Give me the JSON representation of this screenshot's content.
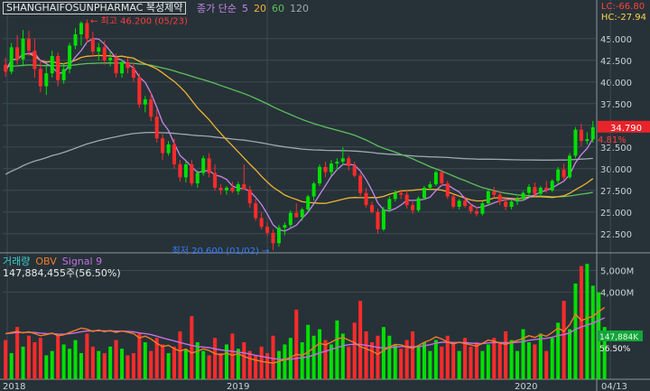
{
  "header": {
    "symbol": "SHANGHAIFOSUNPHARMAC",
    "name": "복성제약",
    "ma_label": "종가 단순",
    "ma_periods": [
      "5",
      "20",
      "60",
      "120"
    ],
    "ma_colors": [
      "#c586e6",
      "#f2b233",
      "#5fbf5f",
      "#9ea7ad"
    ],
    "lc": "LC:-66.80",
    "hc": "HC:-27.94"
  },
  "annotations": {
    "high": "최고 46.200 (05/23)",
    "low": "최저 20.600 (01/02)",
    "last_price": "34.790",
    "last_change": "4.81%"
  },
  "volume_panel": {
    "labels": [
      "거래량",
      "OBV",
      "Signal 9"
    ],
    "label_colors": [
      "#3fd0d0",
      "#f27b2a",
      "#c56fe0"
    ],
    "value": "147,884,455주(56.50%)",
    "last_box": "147,884K",
    "last_pct": "56.50%"
  },
  "colors": {
    "up": "#00e000",
    "down": "#ff2b2b",
    "bg": "#263238",
    "grid": "#3c4a52",
    "obv": "#f27b2a",
    "signal": "#c56fe0",
    "price_box": "#e8232a"
  },
  "chart_data": [
    {
      "type": "candlestick",
      "title": "SHANGHAIFOSUNPHARMAC 복성제약",
      "x_ticks": [
        "2018",
        "2019",
        "2020",
        "04/13"
      ],
      "y_ticks": [
        "22.500",
        "25.000",
        "27.500",
        "30.000",
        "32.500",
        "35.000",
        "37.500",
        "40.000",
        "42.500",
        "45.000"
      ],
      "ylim": [
        20.5,
        48
      ],
      "legend": [
        "종가 단순 5",
        "20",
        "60",
        "120"
      ],
      "candles": [
        [
          42.0,
          42.8,
          40.6,
          41.2
        ],
        [
          41.2,
          44.5,
          40.9,
          44.0
        ],
        [
          44.0,
          45.4,
          42.0,
          42.6
        ],
        [
          42.6,
          46.0,
          41.8,
          45.0
        ],
        [
          45.0,
          45.9,
          43.0,
          43.6
        ],
        [
          43.6,
          45.0,
          40.5,
          41.5
        ],
        [
          41.5,
          42.5,
          38.8,
          39.5
        ],
        [
          39.5,
          42.0,
          38.5,
          41.0
        ],
        [
          41.0,
          43.6,
          40.5,
          43.0
        ],
        [
          43.0,
          43.4,
          39.5,
          40.2
        ],
        [
          40.2,
          42.2,
          39.8,
          41.5
        ],
        [
          41.5,
          44.5,
          41.0,
          44.2
        ],
        [
          44.2,
          46.2,
          43.8,
          45.5
        ],
        [
          45.5,
          47.0,
          44.2,
          46.8
        ],
        [
          46.8,
          47.2,
          44.5,
          45.0
        ],
        [
          45.0,
          45.8,
          43.0,
          43.5
        ],
        [
          43.5,
          44.5,
          42.5,
          44.0
        ],
        [
          44.0,
          44.8,
          42.0,
          42.5
        ],
        [
          42.5,
          43.5,
          41.8,
          42.8
        ],
        [
          42.8,
          43.3,
          40.5,
          41.0
        ],
        [
          41.0,
          42.6,
          40.5,
          42.3
        ],
        [
          42.3,
          42.8,
          41.0,
          41.6
        ],
        [
          41.6,
          42.2,
          40.0,
          40.5
        ],
        [
          40.5,
          41.0,
          37.0,
          37.4
        ],
        [
          37.4,
          38.4,
          36.5,
          38.0
        ],
        [
          38.0,
          38.8,
          35.5,
          36.0
        ],
        [
          36.0,
          36.8,
          33.0,
          33.5
        ],
        [
          33.5,
          34.0,
          31.0,
          31.8
        ],
        [
          31.8,
          33.2,
          31.5,
          32.8
        ],
        [
          32.8,
          33.5,
          30.0,
          30.5
        ],
        [
          30.5,
          31.0,
          28.5,
          29.0
        ],
        [
          29.0,
          30.8,
          28.4,
          30.5
        ],
        [
          30.5,
          31.0,
          28.0,
          28.3
        ],
        [
          28.3,
          29.8,
          27.8,
          29.5
        ],
        [
          29.5,
          31.5,
          29.2,
          31.2
        ],
        [
          31.2,
          31.8,
          29.0,
          29.5
        ],
        [
          29.5,
          30.5,
          27.5,
          27.8
        ],
        [
          27.8,
          28.2,
          27.0,
          27.5
        ],
        [
          27.5,
          28.0,
          27.0,
          27.8
        ],
        [
          27.8,
          28.5,
          27.2,
          27.4
        ],
        [
          27.4,
          28.5,
          27.0,
          28.2
        ],
        [
          28.2,
          30.5,
          27.8,
          27.6
        ],
        [
          27.6,
          28.0,
          25.5,
          26.0
        ],
        [
          26.0,
          26.5,
          24.0,
          24.3
        ],
        [
          24.3,
          25.0,
          23.0,
          23.3
        ],
        [
          23.3,
          23.8,
          22.2,
          22.6
        ],
        [
          22.6,
          23.0,
          20.6,
          21.4
        ],
        [
          21.4,
          23.5,
          21.0,
          23.2
        ],
        [
          23.2,
          23.8,
          22.3,
          23.5
        ],
        [
          23.5,
          25.2,
          23.2,
          24.9
        ],
        [
          24.9,
          26.0,
          24.5,
          24.4
        ],
        [
          24.4,
          25.5,
          24.0,
          25.3
        ],
        [
          25.3,
          27.0,
          25.0,
          26.8
        ],
        [
          26.8,
          28.5,
          26.3,
          28.3
        ],
        [
          28.3,
          30.5,
          28.0,
          30.2
        ],
        [
          30.2,
          30.8,
          29.0,
          29.6
        ],
        [
          29.6,
          31.0,
          29.2,
          30.6
        ],
        [
          30.6,
          31.2,
          29.8,
          30.8
        ],
        [
          30.8,
          32.5,
          30.4,
          31.2
        ],
        [
          31.2,
          31.5,
          29.8,
          30.3
        ],
        [
          30.3,
          30.8,
          29.0,
          29.2
        ],
        [
          29.2,
          29.5,
          26.8,
          27.2
        ],
        [
          27.2,
          27.8,
          25.5,
          25.8
        ],
        [
          25.8,
          26.2,
          24.8,
          25.0
        ],
        [
          25.0,
          25.4,
          22.5,
          23.0
        ],
        [
          23.0,
          25.6,
          22.8,
          25.3
        ],
        [
          25.3,
          26.8,
          25.0,
          26.5
        ],
        [
          26.5,
          27.5,
          26.2,
          27.2
        ],
        [
          27.2,
          27.6,
          26.5,
          27.0
        ],
        [
          27.0,
          27.5,
          25.4,
          25.8
        ],
        [
          25.8,
          26.2,
          24.8,
          25.2
        ],
        [
          25.2,
          26.8,
          25.0,
          26.6
        ],
        [
          26.6,
          28.0,
          26.4,
          27.8
        ],
        [
          27.8,
          28.5,
          27.5,
          28.2
        ],
        [
          28.2,
          29.8,
          28.0,
          29.6
        ],
        [
          29.6,
          29.9,
          28.0,
          28.3
        ],
        [
          28.3,
          28.6,
          26.5,
          26.8
        ],
        [
          26.8,
          27.0,
          25.4,
          25.6
        ],
        [
          25.6,
          26.5,
          25.3,
          26.3
        ],
        [
          26.3,
          26.8,
          25.5,
          25.7
        ],
        [
          25.7,
          26.0,
          24.8,
          25.1
        ],
        [
          25.1,
          25.6,
          24.5,
          24.8
        ],
        [
          24.8,
          26.2,
          24.6,
          26.0
        ],
        [
          26.0,
          27.6,
          25.8,
          27.4
        ],
        [
          27.4,
          27.9,
          26.6,
          27.0
        ],
        [
          27.0,
          27.4,
          25.8,
          26.2
        ],
        [
          26.2,
          26.6,
          25.2,
          25.6
        ],
        [
          25.6,
          26.4,
          25.3,
          26.2
        ],
        [
          26.2,
          26.8,
          25.8,
          26.5
        ],
        [
          26.5,
          27.4,
          26.3,
          27.2
        ],
        [
          27.2,
          28.2,
          26.9,
          27.9
        ],
        [
          27.9,
          28.4,
          26.8,
          27.1
        ],
        [
          27.1,
          28.0,
          26.8,
          27.8
        ],
        [
          27.8,
          28.6,
          27.2,
          27.5
        ],
        [
          27.5,
          28.8,
          27.3,
          28.6
        ],
        [
          28.6,
          30.2,
          28.2,
          29.9
        ],
        [
          29.9,
          30.6,
          28.6,
          29.0
        ],
        [
          29.0,
          31.8,
          28.8,
          31.5
        ],
        [
          31.5,
          34.8,
          31.2,
          34.5
        ],
        [
          34.5,
          35.2,
          32.6,
          33.2
        ],
        [
          33.2,
          34.2,
          32.8,
          33.4
        ],
        [
          33.4,
          35.5,
          33.0,
          34.79
        ]
      ]
    },
    {
      "type": "bar",
      "title": "거래량 / OBV / Signal 9",
      "y_ticks": [
        "4,000M",
        "5,000M"
      ],
      "legend": [
        "거래량",
        "OBV",
        "Signal 9"
      ],
      "volume_m": [
        1800,
        1200,
        2400,
        1500,
        2000,
        1700,
        1900,
        1100,
        1300,
        2000,
        1600,
        1400,
        1800,
        1200,
        2100,
        1500,
        1300,
        1200,
        1500,
        1800,
        1400,
        1100,
        1200,
        2100,
        1700,
        1300,
        1900,
        1600,
        1200,
        1500,
        2200,
        1400,
        2900,
        1700,
        1300,
        1100,
        1900,
        1200,
        1600,
        2100,
        1400,
        1700,
        1300,
        1100,
        1500,
        1200,
        2000,
        1300,
        1600,
        1900,
        3200,
        1700,
        2500,
        2000,
        2300,
        1800,
        1600,
        2700,
        2100,
        1500,
        2600,
        3600,
        2200,
        1700,
        2000,
        2400,
        2000,
        1600,
        1400,
        1800,
        2200,
        1500,
        1700,
        1300,
        1800,
        1500,
        2000,
        1600,
        1300,
        1900,
        1500,
        1700,
        1300,
        1600,
        1900,
        1700,
        2200,
        1800,
        1300,
        2300,
        1700,
        1600,
        2100,
        1300,
        1900,
        2600,
        3600,
        2300,
        4400,
        5200,
        5300,
        4300,
        4000,
        2400
      ],
      "obv_m": [
        2100,
        2150,
        2200,
        2130,
        2180,
        2100,
        2000,
        2050,
        2120,
        2000,
        2040,
        2150,
        2250,
        2350,
        2300,
        2200,
        2260,
        2180,
        2240,
        2150,
        2220,
        2160,
        2100,
        1900,
        1980,
        1850,
        1650,
        1500,
        1560,
        1400,
        1300,
        1380,
        1200,
        1290,
        1400,
        1320,
        1180,
        1120,
        1200,
        1100,
        1180,
        1050,
        950,
        880,
        820,
        780,
        740,
        820,
        900,
        1000,
        1150,
        1100,
        1250,
        1450,
        1650,
        1580,
        1700,
        1850,
        1920,
        1800,
        1680,
        1500,
        1400,
        1300,
        1150,
        1320,
        1480,
        1600,
        1580,
        1480,
        1420,
        1550,
        1700,
        1800,
        1950,
        1850,
        1700,
        1620,
        1700,
        1640,
        1580,
        1520,
        1650,
        1800,
        1750,
        1660,
        1600,
        1700,
        1780,
        1880,
        2000,
        1920,
        2050,
        1980,
        2150,
        2350,
        2200,
        2500,
        3000,
        2700,
        2800,
        2900,
        3100,
        3300
      ],
      "signal_m": [
        2100,
        2120,
        2150,
        2150,
        2160,
        2150,
        2120,
        2100,
        2100,
        2080,
        2070,
        2090,
        2130,
        2180,
        2220,
        2220,
        2230,
        2220,
        2220,
        2210,
        2210,
        2200,
        2180,
        2130,
        2100,
        2050,
        1980,
        1900,
        1830,
        1760,
        1690,
        1620,
        1550,
        1500,
        1480,
        1450,
        1400,
        1350,
        1320,
        1280,
        1250,
        1210,
        1160,
        1100,
        1050,
        1000,
        950,
        920,
        910,
        920,
        960,
        990,
        1030,
        1110,
        1210,
        1290,
        1370,
        1450,
        1540,
        1590,
        1610,
        1600,
        1560,
        1520,
        1460,
        1440,
        1450,
        1480,
        1500,
        1500,
        1490,
        1500,
        1540,
        1590,
        1660,
        1700,
        1700,
        1690,
        1690,
        1680,
        1660,
        1640,
        1640,
        1670,
        1690,
        1690,
        1680,
        1680,
        1700,
        1730,
        1790,
        1820,
        1860,
        1880,
        1930,
        2010,
        2050,
        2130,
        2300,
        2400,
        2490,
        2580,
        2700,
        2820
      ]
    }
  ]
}
